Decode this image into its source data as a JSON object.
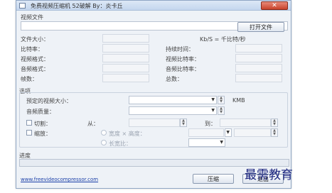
{
  "window": {
    "title": "免费视频压缩机  52破解 By：炎卡丘",
    "close_icon": "close-icon"
  },
  "video_file": {
    "group_label": "视频文件",
    "path_value": "",
    "open_button": "打开文件"
  },
  "info": {
    "file_size_label": "文件大小：",
    "kbs_label": "Kb/S = 千比特/秒",
    "bitrate_label": "比特率：",
    "duration_label": "持续时间：",
    "video_format_label": "视频格式：",
    "video_bitrate_label": "视频比特率：",
    "audio_format_label": "音频格式：",
    "audio_bitrate_label": "音频比特率：",
    "frames_label": "帧数：",
    "total_label": "总数："
  },
  "options": {
    "group_label": "选项",
    "target_size_label": "预定的视频大小：",
    "target_size_unit": "KMB",
    "audio_quality_label": "音频质量：",
    "cut_label": "切割：",
    "from_label": "从：",
    "to_label": "到：",
    "scale_label": "缩放：",
    "custom_size_label": "宽度 × 高度：",
    "ratio_label": "长宽比："
  },
  "progress": {
    "group_label": "进度",
    "value": 0
  },
  "footer": {
    "website": "www.freevideocompressor.com",
    "compress_button": "压缩",
    "exit_button": "退出"
  },
  "watermark": "最需教育"
}
